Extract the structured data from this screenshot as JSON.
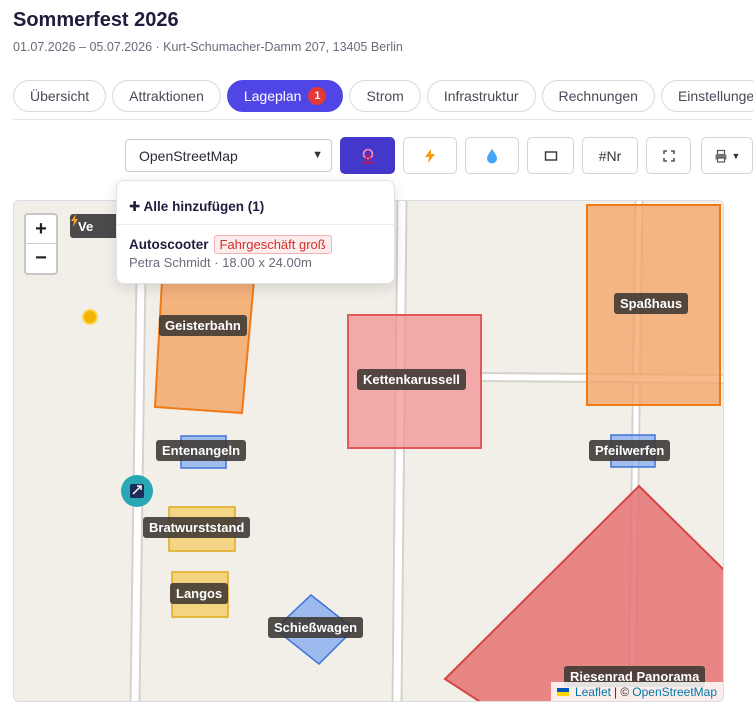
{
  "event": {
    "title": "Sommerfest 2026",
    "subtitle": "01.07.2026 – 05.07.2026 · Kurt-Schumacher-Damm 207, 13405 Berlin"
  },
  "tabs": [
    {
      "label": "Übersicht"
    },
    {
      "label": "Attraktionen"
    },
    {
      "label": "Lageplan",
      "badge": "1",
      "active": true
    },
    {
      "label": "Strom"
    },
    {
      "label": "Infrastruktur"
    },
    {
      "label": "Rechnungen"
    },
    {
      "label": "Einstellungen"
    }
  ],
  "toolbar": {
    "layer_select": "OpenStreetMap",
    "attractions_icon": "ferris-wheel-icon",
    "power_icon": "lightning-icon",
    "water_icon": "water-drop-icon",
    "rect_icon": "rectangle-icon",
    "number_label": "#Nr",
    "fullscreen_icon": "fullscreen-icon",
    "print_icon": "printer-icon"
  },
  "map": {
    "zoom_in": "+",
    "zoom_out": "−",
    "energy_chip": "Ve",
    "attribution": {
      "leaflet": "Leaflet",
      "separator": " | © ",
      "osm": "OpenStreetMap"
    },
    "labels": {
      "geisterbahn": "Geisterbahn",
      "spasshaus": "Spaßhaus",
      "kettenkarussell": "Kettenkarussell",
      "entenangeln": "Entenangeln",
      "pfeilwerfen": "Pfeilwerfen",
      "bratwurststand": "Bratwurststand",
      "langos": "Langos",
      "schiesswagen": "Schießwagen",
      "riesenrad": "Riesenrad Panorama"
    }
  },
  "popover": {
    "add_all": "✚ Alle hinzufügen (1)",
    "item_name": "Autoscooter",
    "item_tag": "Fahrgeschäft groß",
    "item_meta": "Petra Schmidt · 18.00 x 24.00m"
  },
  "colors": {
    "accent": "#4f46e5",
    "badge": "#e53935",
    "orange_fill": "#f4a261",
    "red_fill": "#f28b8b",
    "blue_fill": "#7fa8ef",
    "yellow_fill": "#f3cf6c"
  }
}
